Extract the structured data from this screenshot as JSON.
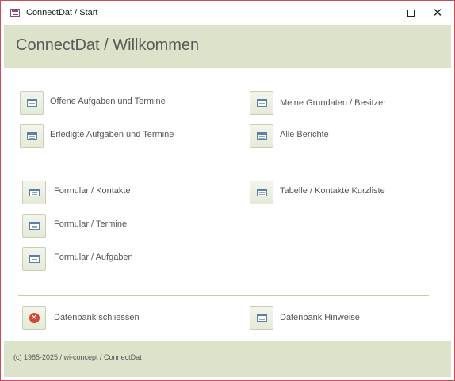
{
  "window": {
    "title": "ConnectDat / Start"
  },
  "header": {
    "title": "ConnectDat / Willkommen"
  },
  "menu": {
    "open_tasks": "Offene Aufgaben und Termine",
    "master_data": "Meine Grundaten / Besitzer",
    "done_tasks": "Erledigte Aufgaben und Termine",
    "all_reports": "Alle Berichte",
    "form_contacts": "Formular / Kontakte",
    "table_contacts_short": "Tabelle / Kontakte Kurzliste",
    "form_appointments": "Formular / Termine",
    "form_tasks": "Formular / Aufgaben",
    "close_db": "Datenbank schliessen",
    "db_notes": "Datenbank Hinweise"
  },
  "footer": {
    "copyright": "(c) 1985-2025 / wi-concept / ConnectDat"
  },
  "colors": {
    "accent_band": "#dde3cb",
    "border": "#c94a5a",
    "close_icon": "#d24a35"
  },
  "icons": {
    "app": "access-form-icon",
    "buttons": "form-icon",
    "close_db": "close-circle-icon"
  }
}
